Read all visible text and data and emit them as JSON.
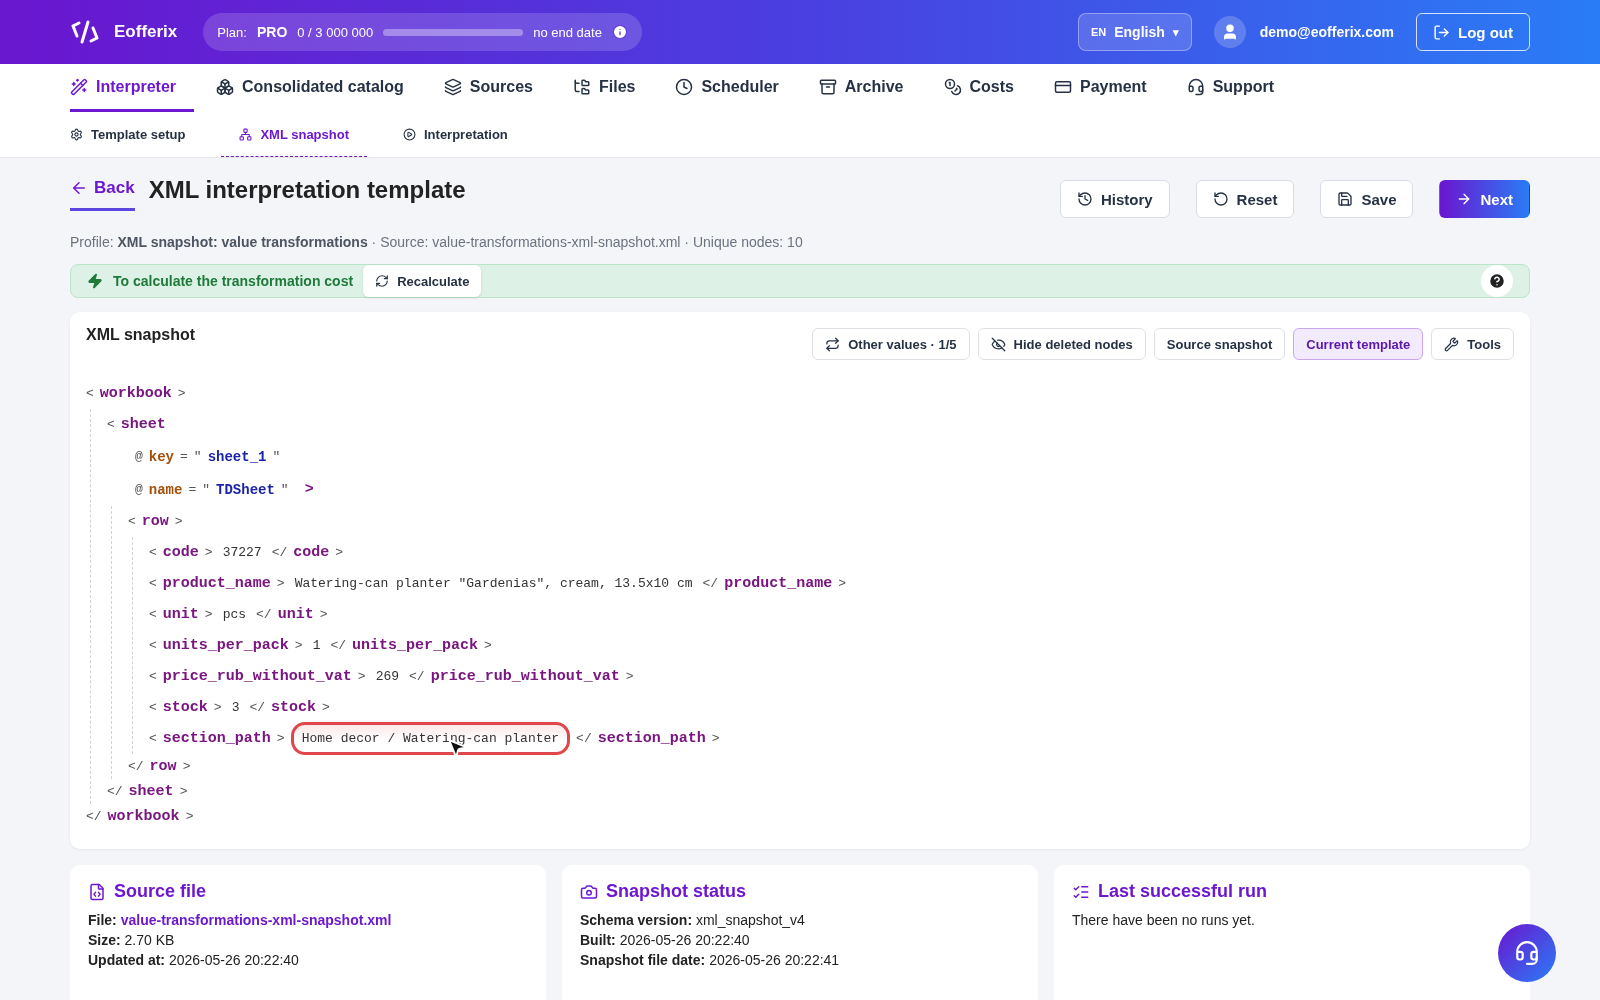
{
  "header": {
    "brand": "Eofferix",
    "plan": {
      "label": "Plan:",
      "name": "PRO",
      "usage": "0 / 3 000 000",
      "level": 0,
      "end": "no end date"
    },
    "language": {
      "code": "EN",
      "label": "English",
      "caret": "▾"
    },
    "user": "demo@eofferix.com",
    "logout": "Log out"
  },
  "nav": [
    {
      "label": "Interpreter",
      "selected": true
    },
    {
      "label": "Consolidated catalog",
      "selected": false
    },
    {
      "label": "Sources",
      "selected": false
    },
    {
      "label": "Files",
      "selected": false
    },
    {
      "label": "Scheduler",
      "selected": false
    },
    {
      "label": "Archive",
      "selected": false
    },
    {
      "label": "Costs",
      "selected": false
    },
    {
      "label": "Payment",
      "selected": false
    },
    {
      "label": "Support",
      "selected": false
    }
  ],
  "subnav": [
    {
      "label": "Template setup",
      "selected": false
    },
    {
      "label": "XML snapshot",
      "selected": true
    },
    {
      "label": "Interpretation",
      "selected": false
    }
  ],
  "page": {
    "back": "Back",
    "title": "XML interpretation template",
    "actions": [
      {
        "label": "History",
        "kind": "plain"
      },
      {
        "label": "Reset",
        "kind": "plain"
      },
      {
        "label": "Save",
        "kind": "plain"
      },
      {
        "label": "Next",
        "kind": "primary"
      }
    ],
    "profile": "Profile: **XML snapshot: value transformations** · Source: value-transformations-xml-snapshot.xml · Unique nodes: 10"
  },
  "notice": {
    "text": "To calculate the transformation cost",
    "button": "Recalculate"
  },
  "snapshot": {
    "title": "XML snapshot",
    "tools": [
      {
        "label": "Other values · 1/5",
        "selected": false
      },
      {
        "label": "Hide deleted nodes",
        "selected": false
      },
      {
        "label": "Source snapshot",
        "selected": false
      },
      {
        "label": "Current template",
        "selected": true
      },
      {
        "label": "Tools",
        "selected": false
      }
    ],
    "syntax": {
      "open": "<",
      "close": ">",
      "end": "</",
      "attr": "@",
      "eq": "=",
      "quote": "\""
    },
    "tree": {
      "name": "workbook",
      "close_name": "workbook",
      "children": [
        {
          "name": "sheet",
          "close_name": "sheet",
          "attributes": [
            {
              "name": "key",
              "value": "sheet_1"
            },
            {
              "name": "name",
              "value": "TDSheet"
            }
          ],
          "children": [
            {
              "name": "row",
              "close_name": "row",
              "children": [
                {
                  "name": "code",
                  "close_name": "code",
                  "value": "37227",
                  "highlighted": false
                },
                {
                  "name": "product_name",
                  "close_name": "product_name",
                  "value": "Watering-can planter \"Gardenias\", cream, 13.5x10 cm",
                  "highlighted": false
                },
                {
                  "name": "unit",
                  "close_name": "unit",
                  "value": "pcs",
                  "highlighted": false
                },
                {
                  "name": "units_per_pack",
                  "close_name": "units_per_pack",
                  "value": "1",
                  "highlighted": false
                },
                {
                  "name": "price_rub_without_vat",
                  "close_name": "price_rub_without_vat",
                  "value": "269",
                  "highlighted": false
                },
                {
                  "name": "stock",
                  "close_name": "stock",
                  "value": "3",
                  "highlighted": false
                },
                {
                  "name": "section_path",
                  "close_name": "section_path",
                  "value": "Home decor / Watering-can planter",
                  "highlighted": true
                }
              ]
            }
          ]
        }
      ]
    }
  },
  "cards": [
    {
      "title": "Source file",
      "lines": [
        {
          "label": "File:",
          "value": "value-transformations-xml-snapshot.xml",
          "kind": "link"
        },
        {
          "label": "Size:",
          "value": "2.70 KB",
          "kind": "text"
        },
        {
          "label": "Updated at:",
          "value": "2026-05-26 20:22:40",
          "kind": "text"
        }
      ]
    },
    {
      "title": "Snapshot status",
      "lines": [
        {
          "label": "Schema version:",
          "value": "xml_snapshot_v4",
          "kind": "text"
        },
        {
          "label": "Built:",
          "value": "2026-05-26 20:22:40",
          "kind": "text"
        },
        {
          "label": "Snapshot file date:",
          "value": "2026-05-26 20:22:41",
          "kind": "text"
        }
      ]
    },
    {
      "title": "Last successful run",
      "text": "There have been no runs yet."
    }
  ]
}
